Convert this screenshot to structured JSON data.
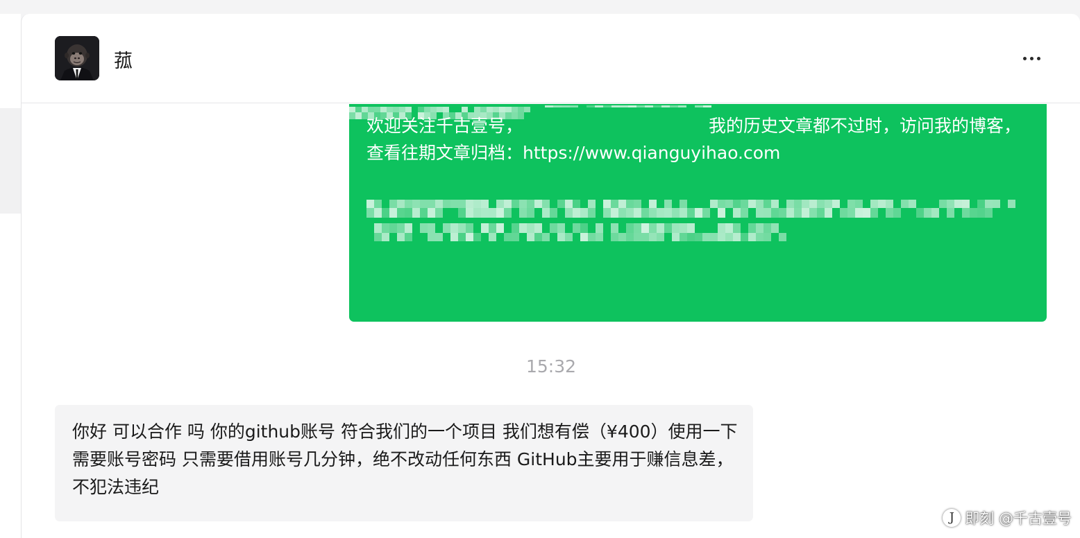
{
  "chat": {
    "title": "菰",
    "avatar_icon": "gorilla-in-suit-avatar",
    "more_icon": "more-horizontal-icon"
  },
  "messages": [
    {
      "direction": "outgoing",
      "bubble_color": "#0ec25e",
      "text_part1": "欢迎关注千古壹号，",
      "text_part2": "我的历史文章都不过时，访问我的博客，查看往期文章归档：https://www.qianguyihao.com",
      "redacted": true
    },
    {
      "direction": "incoming",
      "time": "15:32",
      "bubble_color": "#f4f4f5",
      "text": "你好 可以合作 吗  你的github账号 符合我们的一个项目  我们想有偿（¥400）使用一下  需要账号密码    只需要借用账号几分钟，绝不改动任何东西  GitHub主要用于赚信息差，不犯法违纪"
    }
  ],
  "watermark": {
    "text": "即刻 @千古壹号"
  }
}
